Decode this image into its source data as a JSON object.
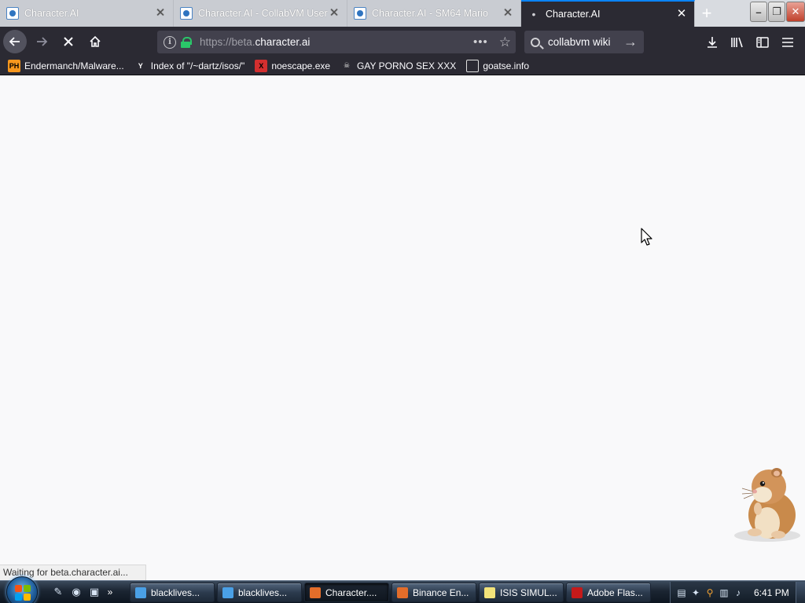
{
  "browser": {
    "tabs": [
      {
        "title": "Character.AI",
        "active": false
      },
      {
        "title": "Character.AI - CollabVM User",
        "active": false
      },
      {
        "title": "Character.AI - SM64 Mario",
        "active": false
      },
      {
        "title": "Character.AI",
        "active": true
      }
    ],
    "url_prefix": "https://beta.",
    "url_domain": "character.ai",
    "search_text": "collabvm wiki",
    "bookmarks": [
      {
        "label": "Endermanch/Malware...",
        "icon": "pornhub-icon",
        "badge": "PH"
      },
      {
        "label": "Index of \"/~dartz/isos/\"",
        "icon": "ycombinator-icon",
        "badge": "Y"
      },
      {
        "label": "noescape.exe",
        "icon": "red-x-icon",
        "badge": "X"
      },
      {
        "label": "GAY PORNO SEX XXX",
        "icon": "skull-icon",
        "badge": "☠"
      },
      {
        "label": "goatse.info",
        "icon": "globe-icon",
        "badge": ""
      }
    ],
    "status_text": "Waiting for beta.character.ai..."
  },
  "taskbar": {
    "tasks": [
      {
        "label": "blacklives...",
        "icon": "ie-icon",
        "active": false
      },
      {
        "label": "blacklives...",
        "icon": "ie-icon",
        "active": false
      },
      {
        "label": "Character....",
        "icon": "firefox-icon",
        "active": true
      },
      {
        "label": "Binance En...",
        "icon": "firefox-icon",
        "active": false
      },
      {
        "label": "ISIS SIMUL...",
        "icon": "notepad-icon",
        "active": false
      },
      {
        "label": "Adobe Flas...",
        "icon": "flash-icon",
        "active": false
      }
    ],
    "clock": "6:41 PM"
  },
  "colors": {
    "chrome_dark": "#2b2a33",
    "accent": "#0a84ff",
    "lock_green": "#2ac769",
    "page_bg": "#f9f9fa"
  }
}
